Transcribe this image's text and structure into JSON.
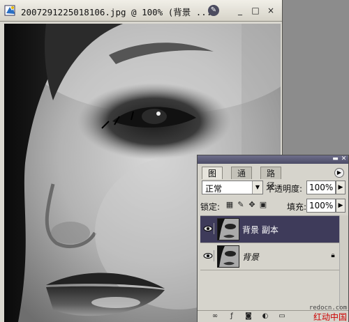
{
  "document": {
    "title": "2007291225018106.jpg @ 100% (背景 ...",
    "buttons": {
      "minimize": "_",
      "maximize": "□",
      "close": "×"
    }
  },
  "layers_panel": {
    "tabs": [
      {
        "label": "图层",
        "active": true
      },
      {
        "label": "通道",
        "active": false
      },
      {
        "label": "路径",
        "active": false
      }
    ],
    "blend_mode": "正常",
    "opacity_label": "不透明度:",
    "opacity_value": "100%",
    "lock_label": "锁定:",
    "fill_label": "填充:",
    "fill_value": "100%",
    "layers": [
      {
        "name": "背景 副本",
        "selected": true,
        "locked": false
      },
      {
        "name": "背景",
        "selected": false,
        "locked": true
      }
    ]
  },
  "watermark": {
    "url": "redocn.com",
    "text": "红动中国"
  },
  "colors": {
    "selected_layer": "#3e3b5a",
    "panel_bg": "#d6d4cc",
    "titlebar": "#e4e2da"
  }
}
